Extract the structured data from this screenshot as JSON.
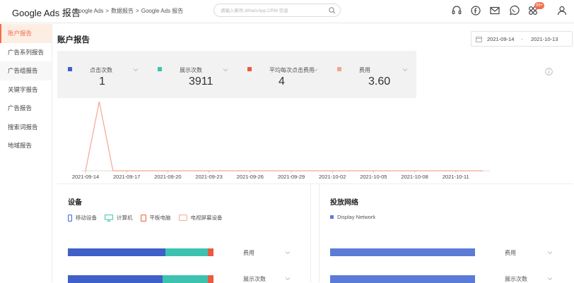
{
  "topbar": {
    "app_title": "Google Ads 报告",
    "breadcrumb": [
      "Google Ads",
      "数据报告",
      "Google Ads 报告"
    ],
    "breadcrumb_sep": ">",
    "search_placeholder": "请输入邮件,WhatsApp,CRM 信息",
    "notification_count": "99+",
    "icons": [
      "headset-icon",
      "facebook-icon",
      "mail-icon",
      "whatsapp-icon",
      "apps-icon",
      "user-icon"
    ]
  },
  "sidebar": {
    "items": [
      {
        "label": "账户报告",
        "state": "active"
      },
      {
        "label": "广告系列报告",
        "state": ""
      },
      {
        "label": "广告组报告",
        "state": "highlighted"
      },
      {
        "label": "关键字报告",
        "state": ""
      },
      {
        "label": "广告报告",
        "state": ""
      },
      {
        "label": "搜索词报告",
        "state": ""
      },
      {
        "label": "地域报告",
        "state": ""
      }
    ]
  },
  "main": {
    "title": "账户报告",
    "date_start": "2021-09-14",
    "date_sep": "-",
    "date_end": "2021-10-13",
    "metrics": [
      {
        "label": "点击次数",
        "value": "1",
        "color": "#3f5fc9"
      },
      {
        "label": "展示次数",
        "value": "3911",
        "color": "#3cc3b0"
      },
      {
        "label": "平均每次点击费用",
        "value": "4",
        "color": "#ea5a3c"
      },
      {
        "label": "费用",
        "value": "3.60",
        "color": "#f5a594"
      }
    ]
  },
  "chart_data": {
    "type": "line",
    "x_tick_labels": [
      "2021-09-14",
      "2021-09-17",
      "2021-09-20",
      "2021-09-23",
      "2021-09-26",
      "2021-09-29",
      "2021-10-02",
      "2021-10-05",
      "2021-10-08",
      "2021-10-11"
    ],
    "x": [
      "2021-09-14",
      "2021-09-15",
      "2021-09-16",
      "2021-09-17",
      "2021-09-18",
      "2021-09-19",
      "2021-09-20",
      "2021-09-21",
      "2021-09-22",
      "2021-09-23",
      "2021-09-24",
      "2021-09-25",
      "2021-09-26",
      "2021-09-27",
      "2021-09-28",
      "2021-09-29",
      "2021-09-30",
      "2021-10-01",
      "2021-10-02",
      "2021-10-03",
      "2021-10-04",
      "2021-10-05",
      "2021-10-06",
      "2021-10-07",
      "2021-10-08",
      "2021-10-09",
      "2021-10-10",
      "2021-10-11",
      "2021-10-12",
      "2021-10-13"
    ],
    "series": [
      {
        "values": [
          0,
          3.6,
          0,
          0,
          0,
          0,
          0,
          0,
          0,
          0,
          0,
          0,
          0,
          0,
          0,
          0,
          0,
          0,
          0,
          0,
          0,
          0,
          0,
          0,
          0,
          0,
          0,
          0,
          0,
          0
        ],
        "color": "#f5a594"
      }
    ],
    "ylim": [
      0,
      3.6
    ],
    "grid": false,
    "legend": "none"
  },
  "devices": {
    "title": "设备",
    "legend": [
      {
        "label": "移动设备",
        "icon": "mobile-icon",
        "color": "#3f5fc9"
      },
      {
        "label": "计算机",
        "icon": "computer-icon",
        "color": "#3cc3b0"
      },
      {
        "label": "平板电脑",
        "icon": "tablet-icon",
        "color": "#ea5a3c"
      },
      {
        "label": "电视屏幕设备",
        "icon": "tv-icon",
        "color": "#f5a594"
      }
    ],
    "rows": [
      {
        "label": "费用",
        "segments": [
          0.67,
          0.29,
          0.04,
          0.0
        ]
      },
      {
        "label": "展示次数",
        "segments": [
          0.65,
          0.31,
          0.04,
          0.0
        ]
      }
    ]
  },
  "network": {
    "title": "投放网络",
    "legend": [
      {
        "label": "Display Network",
        "color": "#5b7bd6"
      }
    ],
    "rows": [
      {
        "label": "费用",
        "segments": [
          1.0
        ]
      },
      {
        "label": "展示次数",
        "segments": [
          1.0
        ]
      }
    ]
  }
}
